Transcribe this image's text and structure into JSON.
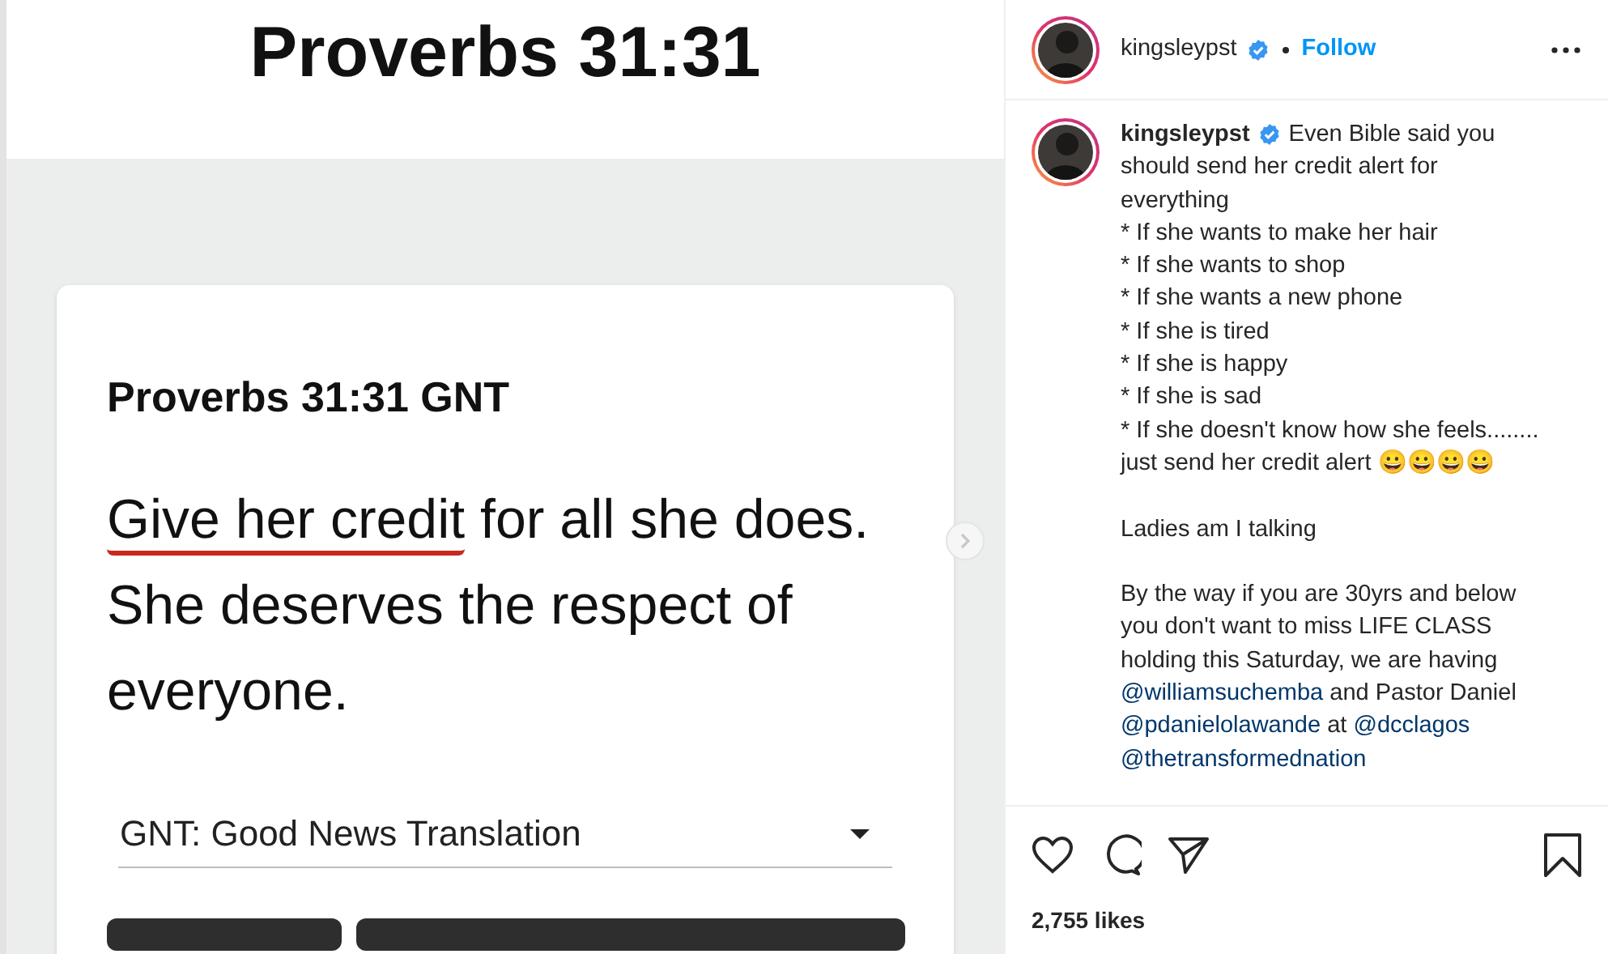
{
  "post_image": {
    "heading": "Proverbs 31:31",
    "card": {
      "title": "Proverbs 31:31 GNT",
      "verse": [
        {
          "text": "Give her credit",
          "underlined": true
        },
        {
          "text": " for all she does. She deserves the respect of everyone.",
          "underlined": false
        }
      ],
      "version_select": {
        "value": "GNT: Good News Translation"
      }
    }
  },
  "header": {
    "username": "kingsleypst",
    "verified": true,
    "follow": "Follow"
  },
  "caption": {
    "username": "kingsleypst",
    "verified": true,
    "paragraphs": [
      [
        [
          {
            "kind": "text",
            "text": "Even Bible said you"
          }
        ],
        [
          {
            "kind": "text",
            "text": "should send her credit alert for"
          }
        ],
        [
          {
            "kind": "text",
            "text": "everything"
          }
        ],
        [
          {
            "kind": "text",
            "text": "* If she wants to make her hair"
          }
        ],
        [
          {
            "kind": "text",
            "text": "* If she wants to shop"
          }
        ],
        [
          {
            "kind": "text",
            "text": "* If she wants a new phone"
          }
        ],
        [
          {
            "kind": "text",
            "text": "* If she is tired"
          }
        ],
        [
          {
            "kind": "text",
            "text": "* If she is happy"
          }
        ],
        [
          {
            "kind": "text",
            "text": "* If she is sad"
          }
        ],
        [
          {
            "kind": "text",
            "text": "* If she doesn't know how she feels........"
          }
        ],
        [
          {
            "kind": "text",
            "text": "just send her credit alert 😀😀😀😀"
          }
        ]
      ],
      [
        [
          {
            "kind": "text",
            "text": "Ladies am I talking"
          }
        ]
      ],
      [
        [
          {
            "kind": "text",
            "text": "By the way if you are 30yrs and below"
          }
        ],
        [
          {
            "kind": "text",
            "text": "you don't want to miss LIFE CLASS"
          }
        ],
        [
          {
            "kind": "text",
            "text": "holding this Saturday, we are having"
          }
        ],
        [
          {
            "kind": "mention",
            "text": "@williamsuchemba"
          },
          {
            "kind": "text",
            "text": " and Pastor Daniel"
          }
        ],
        [
          {
            "kind": "mention",
            "text": "@pdanielolawande"
          },
          {
            "kind": "text",
            "text": " at "
          },
          {
            "kind": "mention",
            "text": "@dcclagos"
          }
        ],
        [
          {
            "kind": "mention",
            "text": "@thetransformednation"
          }
        ]
      ]
    ]
  },
  "likes": "2,755 likes"
}
